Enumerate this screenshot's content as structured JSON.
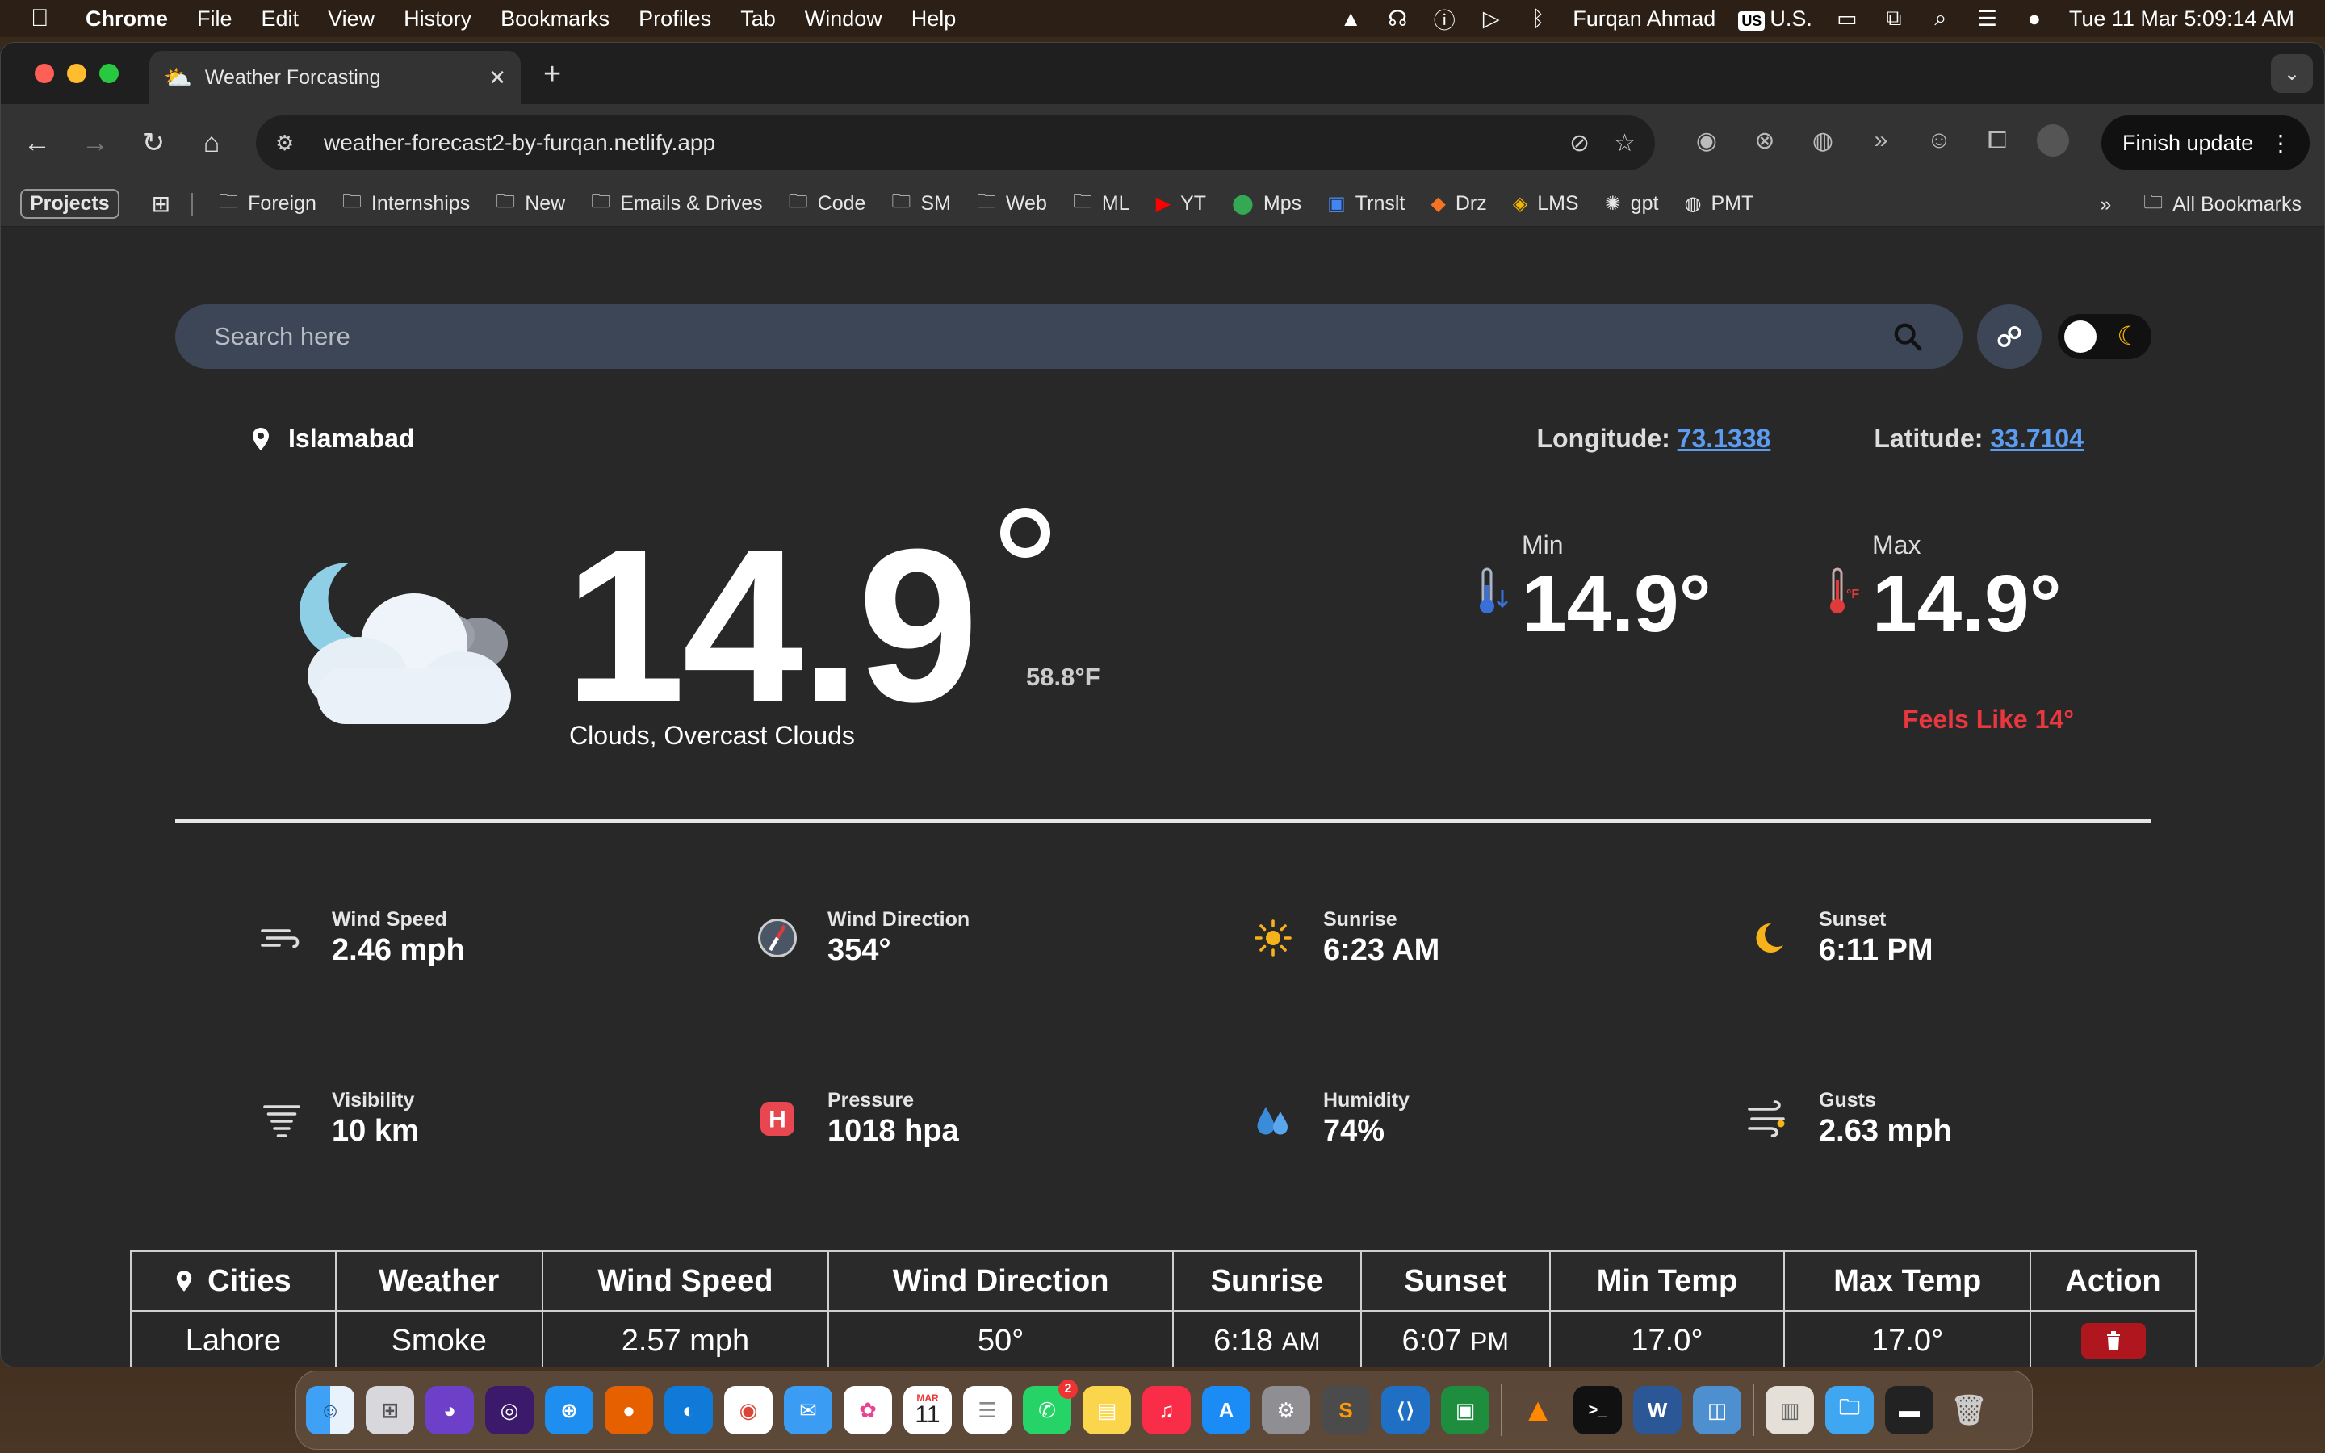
{
  "menubar": {
    "app_name": "Chrome",
    "menus": [
      "File",
      "Edit",
      "View",
      "History",
      "Bookmarks",
      "Profiles",
      "Tab",
      "Window",
      "Help"
    ],
    "user": "Furqan Ahmad",
    "input_source_badge": "US",
    "input_source": "U.S.",
    "datetime": "Tue 11 Mar  5:09:14 AM"
  },
  "browser": {
    "tab_title": "Weather Forcasting",
    "url": "weather-forecast2-by-furqan.netlify.app",
    "finish_update_label": "Finish update",
    "bookmarks": {
      "projects": "Projects",
      "items": [
        "Foreign",
        "Internships",
        "New",
        "Emails & Drives",
        "Code",
        "SM",
        "Web",
        "ML",
        "YT",
        "Mps",
        "Trnslt",
        "Drz",
        "LMS",
        "gpt",
        "PMT"
      ],
      "all_bookmarks": "All Bookmarks"
    }
  },
  "search": {
    "placeholder": "Search here"
  },
  "location": {
    "city": "Islamabad",
    "longitude_label": "Longitude:",
    "longitude": "73.1338",
    "latitude_label": "Latitude:",
    "latitude": "33.7104"
  },
  "current": {
    "temp": "14.9",
    "temp_f": "58.8°F",
    "condition": "Clouds, Overcast Clouds",
    "min_label": "Min",
    "min": "14.9°",
    "max_label": "Max",
    "max": "14.9°",
    "feels_like": "Feels Like 14°"
  },
  "stats": [
    {
      "label": "Wind Speed",
      "value": "2.46 mph",
      "icon": "wind-icon"
    },
    {
      "label": "Wind Direction",
      "value": "354°",
      "icon": "compass-icon"
    },
    {
      "label": "Sunrise",
      "value": "6:23 AM",
      "icon": "sun-icon"
    },
    {
      "label": "Sunset",
      "value": "6:11 PM",
      "icon": "moon-icon"
    },
    {
      "label": "Visibility",
      "value": "10 km",
      "icon": "visibility-icon"
    },
    {
      "label": "Pressure",
      "value": "1018 hpa",
      "icon": "pressure-icon"
    },
    {
      "label": "Humidity",
      "value": "74%",
      "icon": "humidity-icon"
    },
    {
      "label": "Gusts",
      "value": "2.63 mph",
      "icon": "gusts-icon"
    }
  ],
  "table": {
    "headers": [
      "Cities",
      "Weather",
      "Wind Speed",
      "Wind Direction",
      "Sunrise",
      "Sunset",
      "Min Temp",
      "Max Temp",
      "Action"
    ],
    "rows": [
      {
        "city": "Lahore",
        "weather": "Smoke",
        "wind_speed": "2.57 mph",
        "wind_direction": "50°",
        "sunrise": "6:18",
        "sunrise_ampm": "AM",
        "sunset": "6:07",
        "sunset_ampm": "PM",
        "min_temp": "17.0°",
        "max_temp": "17.0°"
      }
    ]
  },
  "dock": {
    "calendar_month": "MAR",
    "calendar_day": "11",
    "whatsapp_badge": "2"
  },
  "colors": {
    "page_bg": "#282828",
    "search_bg": "#3c4656",
    "link_blue": "#5b9bf0",
    "feels_red": "#e8373e",
    "delete_red": "#b0161e"
  }
}
